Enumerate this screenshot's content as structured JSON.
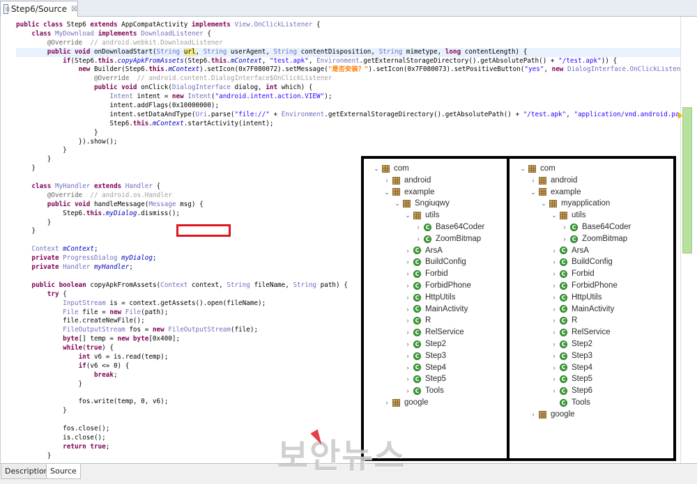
{
  "editor_tab": {
    "label": "Step6/Source",
    "close": "☒"
  },
  "code": {
    "lines": [
      [
        [
          "kw",
          "public class "
        ],
        [
          "n",
          "Step6 "
        ],
        [
          "kw",
          "extends "
        ],
        [
          "n",
          "AppCompatActivity "
        ],
        [
          "kw",
          "implements "
        ],
        [
          "ty",
          "View.OnClickListener "
        ],
        [
          "n",
          "{"
        ]
      ],
      [
        [
          "n",
          "    "
        ],
        [
          "kw",
          "class "
        ],
        [
          "ty",
          "MyDownload "
        ],
        [
          "kw",
          "implements "
        ],
        [
          "ty",
          "DownloadListener "
        ],
        [
          "n",
          "{"
        ]
      ],
      [
        [
          "n",
          "        "
        ],
        [
          "ann",
          "@Override  "
        ],
        [
          "cmt",
          "// android.webkit.DownloadListener"
        ]
      ],
      [
        [
          "n",
          "        "
        ],
        [
          "kw",
          "public void "
        ],
        [
          "n",
          "onDownloadStart("
        ],
        [
          "ty",
          "String "
        ],
        [
          "mark",
          "url"
        ],
        [
          "n",
          ", "
        ],
        [
          "ty",
          "String "
        ],
        [
          "n",
          "userAgent, "
        ],
        [
          "ty",
          "String "
        ],
        [
          "n",
          "contentDisposition, "
        ],
        [
          "ty",
          "String "
        ],
        [
          "n",
          "mimetype, "
        ],
        [
          "kw",
          "long "
        ],
        [
          "n",
          "contentLength) {"
        ]
      ],
      [
        [
          "n",
          "            "
        ],
        [
          "kw",
          "if"
        ],
        [
          "n",
          "(Step6."
        ],
        [
          "kw",
          "this"
        ],
        [
          "n",
          "."
        ],
        [
          "fld",
          "copyApkFromAssets"
        ],
        [
          "n",
          "(Step6."
        ],
        [
          "kw",
          "this"
        ],
        [
          "n",
          "."
        ],
        [
          "fld",
          "mContext"
        ],
        [
          "n",
          ", "
        ],
        [
          "str",
          "\"test.apk\""
        ],
        [
          "n",
          ", "
        ],
        [
          "ty",
          "Environment"
        ],
        [
          "n",
          ".getExternalStorageDirectory().getAbsolutePath() + "
        ],
        [
          "str",
          "\"/test.apk\""
        ],
        [
          "n",
          ")) {"
        ]
      ],
      [
        [
          "n",
          "                "
        ],
        [
          "kw",
          "new "
        ],
        [
          "n",
          "Builder(Step6."
        ],
        [
          "kw",
          "this"
        ],
        [
          "n",
          "."
        ],
        [
          "fld",
          "mContext"
        ],
        [
          "n",
          ").setIcon(0x7F080072).setMessage("
        ],
        [
          "str-ko",
          "\"是否安装？\""
        ],
        [
          "n",
          ").setIcon(0x7F080073).setPositiveButton("
        ],
        [
          "str",
          "\"yes\""
        ],
        [
          "n",
          ", "
        ],
        [
          "kw",
          "new "
        ],
        [
          "ty",
          "DialogInterface.OnClickListener"
        ],
        [
          "n",
          "() {"
        ]
      ],
      [
        [
          "n",
          "                    "
        ],
        [
          "ann",
          "@Override  "
        ],
        [
          "cmt",
          "// android.content.DialogInterface$OnClickListener"
        ]
      ],
      [
        [
          "n",
          "                    "
        ],
        [
          "kw",
          "public void "
        ],
        [
          "n",
          "onClick("
        ],
        [
          "ty",
          "DialogInterface "
        ],
        [
          "n",
          "dialog, "
        ],
        [
          "kw",
          "int "
        ],
        [
          "n",
          "which) {"
        ]
      ],
      [
        [
          "n",
          "                        "
        ],
        [
          "ty",
          "Intent "
        ],
        [
          "n",
          "intent = "
        ],
        [
          "kw",
          "new "
        ],
        [
          "ty",
          "Intent"
        ],
        [
          "n",
          "("
        ],
        [
          "str",
          "\"android.intent.action.VIEW\""
        ],
        [
          "n",
          ");"
        ]
      ],
      [
        [
          "n",
          "                        intent.addFlags(0x10000000);"
        ]
      ],
      [
        [
          "n",
          "                        intent.setDataAndType("
        ],
        [
          "ty",
          "Uri"
        ],
        [
          "n",
          ".parse("
        ],
        [
          "str",
          "\"file://\""
        ],
        [
          "n",
          " + "
        ],
        [
          "ty",
          "Environment"
        ],
        [
          "n",
          ".getExternalStorageDirectory().getAbsolutePath() + "
        ],
        [
          "str",
          "\"/test.apk\""
        ],
        [
          "n",
          ", "
        ],
        [
          "str",
          "\"application/vnd.android.package-archive\""
        ],
        [
          "n",
          ");"
        ]
      ],
      [
        [
          "n",
          "                        Step6."
        ],
        [
          "kw",
          "this"
        ],
        [
          "n",
          "."
        ],
        [
          "fld",
          "mContext"
        ],
        [
          "n",
          ".startActivity(intent);"
        ]
      ],
      [
        [
          "n",
          "                    }"
        ]
      ],
      [
        [
          "n",
          "                }).show();"
        ]
      ],
      [
        [
          "n",
          "            }"
        ]
      ],
      [
        [
          "n",
          "        }"
        ]
      ],
      [
        [
          "n",
          "    }"
        ]
      ],
      [
        [
          "n",
          ""
        ]
      ],
      [
        [
          "n",
          "    "
        ],
        [
          "kw",
          "class "
        ],
        [
          "ty",
          "MyHandler "
        ],
        [
          "kw",
          "extends "
        ],
        [
          "ty",
          "Handler "
        ],
        [
          "n",
          "{"
        ]
      ],
      [
        [
          "n",
          "        "
        ],
        [
          "ann",
          "@Override  "
        ],
        [
          "cmt",
          "// android.os.Handler"
        ]
      ],
      [
        [
          "n",
          "        "
        ],
        [
          "kw",
          "public void "
        ],
        [
          "n",
          "handleMessage("
        ],
        [
          "ty",
          "Message "
        ],
        [
          "n",
          "msg) {"
        ]
      ],
      [
        [
          "n",
          "            Step6."
        ],
        [
          "kw",
          "this"
        ],
        [
          "n",
          "."
        ],
        [
          "fld",
          "myDialog"
        ],
        [
          "n",
          ".dismiss();"
        ]
      ],
      [
        [
          "n",
          "        }"
        ]
      ],
      [
        [
          "n",
          "    }"
        ]
      ],
      [
        [
          "n",
          ""
        ]
      ],
      [
        [
          "n",
          "    "
        ],
        [
          "ty",
          "Context "
        ],
        [
          "fld",
          "mContext"
        ],
        [
          "n",
          ";"
        ]
      ],
      [
        [
          "n",
          "    "
        ],
        [
          "kw",
          "private "
        ],
        [
          "ty",
          "ProgressDialog "
        ],
        [
          "fld",
          "myDialog"
        ],
        [
          "n",
          ";"
        ]
      ],
      [
        [
          "n",
          "    "
        ],
        [
          "kw",
          "private "
        ],
        [
          "ty",
          "Handler "
        ],
        [
          "fld",
          "myHandler"
        ],
        [
          "n",
          ";"
        ]
      ],
      [
        [
          "n",
          ""
        ]
      ],
      [
        [
          "n",
          "    "
        ],
        [
          "kw",
          "public boolean "
        ],
        [
          "n",
          "copyApkFromAssets("
        ],
        [
          "ty",
          "Context "
        ],
        [
          "n",
          "context, "
        ],
        [
          "ty",
          "String "
        ],
        [
          "n",
          "fileName, "
        ],
        [
          "ty",
          "String "
        ],
        [
          "n",
          "path) {"
        ]
      ],
      [
        [
          "n",
          "        "
        ],
        [
          "kw",
          "try "
        ],
        [
          "n",
          "{"
        ]
      ],
      [
        [
          "n",
          "            "
        ],
        [
          "ty",
          "InputStream "
        ],
        [
          "n",
          "is = context.getAssets().open(fileName);"
        ]
      ],
      [
        [
          "n",
          "            "
        ],
        [
          "ty",
          "File "
        ],
        [
          "n",
          "file = "
        ],
        [
          "kw",
          "new "
        ],
        [
          "ty",
          "File"
        ],
        [
          "n",
          "(path);"
        ]
      ],
      [
        [
          "n",
          "            file.createNewFile();"
        ]
      ],
      [
        [
          "n",
          "            "
        ],
        [
          "ty",
          "FileOutputStream "
        ],
        [
          "n",
          "fos = "
        ],
        [
          "kw",
          "new "
        ],
        [
          "ty",
          "FileOutputStream"
        ],
        [
          "n",
          "(file);"
        ]
      ],
      [
        [
          "n",
          "            "
        ],
        [
          "kw",
          "byte"
        ],
        [
          "n",
          "[] temp = "
        ],
        [
          "kw",
          "new byte"
        ],
        [
          "n",
          "[0x400];"
        ]
      ],
      [
        [
          "n",
          "            "
        ],
        [
          "kw",
          "while"
        ],
        [
          "n",
          "("
        ],
        [
          "kw",
          "true"
        ],
        [
          "n",
          ") {"
        ]
      ],
      [
        [
          "n",
          "                "
        ],
        [
          "kw",
          "int "
        ],
        [
          "n",
          "v6 = is.read(temp);"
        ]
      ],
      [
        [
          "n",
          "                "
        ],
        [
          "kw",
          "if"
        ],
        [
          "n",
          "(v6 <= 0) {"
        ]
      ],
      [
        [
          "n",
          "                    "
        ],
        [
          "kw",
          "break"
        ],
        [
          "n",
          ";"
        ]
      ],
      [
        [
          "n",
          "                }"
        ]
      ],
      [
        [
          "n",
          ""
        ]
      ],
      [
        [
          "n",
          "                fos.write(temp, 0, v6);"
        ]
      ],
      [
        [
          "n",
          "            }"
        ]
      ],
      [
        [
          "n",
          ""
        ]
      ],
      [
        [
          "n",
          "            fos.close();"
        ]
      ],
      [
        [
          "n",
          "            is.close();"
        ]
      ],
      [
        [
          "n",
          "            "
        ],
        [
          "kw",
          "return true"
        ],
        [
          "n",
          ";"
        ]
      ],
      [
        [
          "n",
          "        }"
        ]
      ]
    ],
    "highlighted_line": 3
  },
  "bottom_tabs": [
    {
      "label": "Description",
      "active": false
    },
    {
      "label": "Source",
      "active": true
    }
  ],
  "tree_left": [
    {
      "depth": 0,
      "twisty": "open",
      "icon": "package",
      "label": "com"
    },
    {
      "depth": 1,
      "twisty": "closed",
      "icon": "package",
      "label": "android"
    },
    {
      "depth": 1,
      "twisty": "open",
      "icon": "package",
      "label": "example"
    },
    {
      "depth": 2,
      "twisty": "open",
      "icon": "package",
      "label": "Sngiuqwy"
    },
    {
      "depth": 3,
      "twisty": "open",
      "icon": "package",
      "label": "utils"
    },
    {
      "depth": 4,
      "twisty": "closed",
      "icon": "class",
      "label": "Base64Coder"
    },
    {
      "depth": 4,
      "twisty": "closed",
      "icon": "class",
      "label": "ZoomBitmap"
    },
    {
      "depth": 3,
      "twisty": "closed",
      "icon": "class",
      "label": "ArsA"
    },
    {
      "depth": 3,
      "twisty": "closed",
      "icon": "class",
      "label": "BuildConfig"
    },
    {
      "depth": 3,
      "twisty": "closed",
      "icon": "class",
      "label": "Forbid"
    },
    {
      "depth": 3,
      "twisty": "closed",
      "icon": "class",
      "label": "ForbidPhone"
    },
    {
      "depth": 3,
      "twisty": "closed",
      "icon": "class",
      "label": "HttpUtils"
    },
    {
      "depth": 3,
      "twisty": "closed",
      "icon": "class",
      "label": "MainActivity"
    },
    {
      "depth": 3,
      "twisty": "closed",
      "icon": "class",
      "label": "R"
    },
    {
      "depth": 3,
      "twisty": "closed",
      "icon": "class",
      "label": "RelService"
    },
    {
      "depth": 3,
      "twisty": "closed",
      "icon": "class",
      "label": "Step2"
    },
    {
      "depth": 3,
      "twisty": "closed",
      "icon": "class",
      "label": "Step3"
    },
    {
      "depth": 3,
      "twisty": "closed",
      "icon": "class",
      "label": "Step4"
    },
    {
      "depth": 3,
      "twisty": "closed",
      "icon": "class",
      "label": "Step5"
    },
    {
      "depth": 3,
      "twisty": "closed",
      "icon": "class",
      "label": "Tools"
    },
    {
      "depth": 1,
      "twisty": "closed",
      "icon": "package",
      "label": "google"
    }
  ],
  "tree_right": [
    {
      "depth": 0,
      "twisty": "open",
      "icon": "package",
      "label": "com"
    },
    {
      "depth": 1,
      "twisty": "closed",
      "icon": "package",
      "label": "android"
    },
    {
      "depth": 1,
      "twisty": "open",
      "icon": "package",
      "label": "example"
    },
    {
      "depth": 2,
      "twisty": "open",
      "icon": "package",
      "label": "myapplication"
    },
    {
      "depth": 3,
      "twisty": "open",
      "icon": "package",
      "label": "utils"
    },
    {
      "depth": 4,
      "twisty": "closed",
      "icon": "class",
      "label": "Base64Coder"
    },
    {
      "depth": 4,
      "twisty": "closed",
      "icon": "class",
      "label": "ZoomBitmap"
    },
    {
      "depth": 3,
      "twisty": "closed",
      "icon": "class",
      "label": "ArsA"
    },
    {
      "depth": 3,
      "twisty": "closed",
      "icon": "class",
      "label": "BuildConfig"
    },
    {
      "depth": 3,
      "twisty": "closed",
      "icon": "class",
      "label": "Forbid"
    },
    {
      "depth": 3,
      "twisty": "closed",
      "icon": "class",
      "label": "ForbidPhone"
    },
    {
      "depth": 3,
      "twisty": "closed",
      "icon": "class",
      "label": "HttpUtils"
    },
    {
      "depth": 3,
      "twisty": "closed",
      "icon": "class",
      "label": "MainActivity"
    },
    {
      "depth": 3,
      "twisty": "closed",
      "icon": "class",
      "label": "R"
    },
    {
      "depth": 3,
      "twisty": "closed",
      "icon": "class",
      "label": "RelService"
    },
    {
      "depth": 3,
      "twisty": "closed",
      "icon": "class",
      "label": "Step2"
    },
    {
      "depth": 3,
      "twisty": "closed",
      "icon": "class",
      "label": "Step3"
    },
    {
      "depth": 3,
      "twisty": "closed",
      "icon": "class",
      "label": "Step4"
    },
    {
      "depth": 3,
      "twisty": "closed",
      "icon": "class",
      "label": "Step5"
    },
    {
      "depth": 3,
      "twisty": "closed",
      "icon": "class",
      "label": "Step6",
      "highlighted": true
    },
    {
      "depth": 3,
      "twisty": "none",
      "icon": "class",
      "label": "Tools"
    },
    {
      "depth": 1,
      "twisty": "closed",
      "icon": "package",
      "label": "google"
    }
  ],
  "highlight_color": "#e0141e",
  "watermark": "보안뉴스"
}
